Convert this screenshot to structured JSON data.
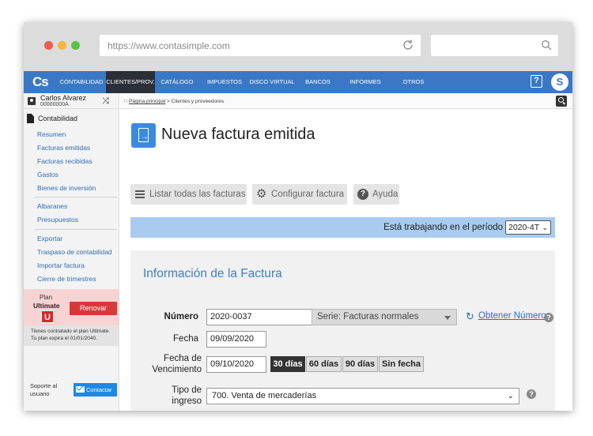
{
  "browser": {
    "url": "https://www.contasimple.com"
  },
  "nav": {
    "logo": "Cs",
    "items": [
      "CONTABILIDAD",
      "CLIENTES/PROV.",
      "CATÁLOGO",
      "IMPUESTOS",
      "DISCO VIRTUAL",
      "BANCOS",
      "INFORMES",
      "OTROS"
    ],
    "active": "CLIENTES/PROV.",
    "help": "?",
    "avatar": "S"
  },
  "user": {
    "name": "Carlos Alvarez",
    "id": "00000000A"
  },
  "sidebar": {
    "section": "Contabilidad",
    "group1": [
      "Resumen",
      "Facturas emitidas",
      "Facturas recibidas",
      "Gastos",
      "Bienes de inversión"
    ],
    "group2": [
      "Albaranes",
      "Presupuestos"
    ],
    "group3": [
      "Exportar",
      "Traspaso de contabilidad",
      "Importar factura",
      "Cierre de trimestres"
    ],
    "plan_label": "Plan",
    "plan_name": "Ultimate",
    "plan_badge": "U",
    "renew": "Renovar",
    "plan_note": "Tienes contratado el plan Ultimate. Tu plan expira el 01/01/2040.",
    "support": "Soporte al usuario",
    "contact": "Contactar"
  },
  "breadcrumb": {
    "home": "Página principal",
    "current": "> Clientes y proveedores"
  },
  "page": {
    "title": "Nueva factura emitida"
  },
  "toolbar": {
    "list": "Listar todas las facturas",
    "config": "Configurar factura",
    "help": "Ayuda"
  },
  "period": {
    "label": "Está trabajando en el período",
    "value": "2020-4T"
  },
  "form": {
    "heading": "Información de la Factura",
    "numero_label": "Número",
    "numero": "2020-0037",
    "serie": "Serie: Facturas normales",
    "obtener": "Obtener Número",
    "fecha_label": "Fecha",
    "fecha": "09/09/2020",
    "venc_label_1": "Fecha de",
    "venc_label_2": "Vencimiento",
    "vencimiento": "09/10/2020",
    "days": [
      "30 días",
      "60 días",
      "90 días",
      "Sin fecha"
    ],
    "days_active": "30 días",
    "tipo_label_1": "Tipo de",
    "tipo_label_2": "ingreso",
    "tipo": "700. Venta de mercaderías"
  },
  "colors": {
    "nav_blue": "#3a78c5",
    "period_bar": "#a9cbf0",
    "link": "#2f6db7",
    "renew": "#d9383b"
  }
}
